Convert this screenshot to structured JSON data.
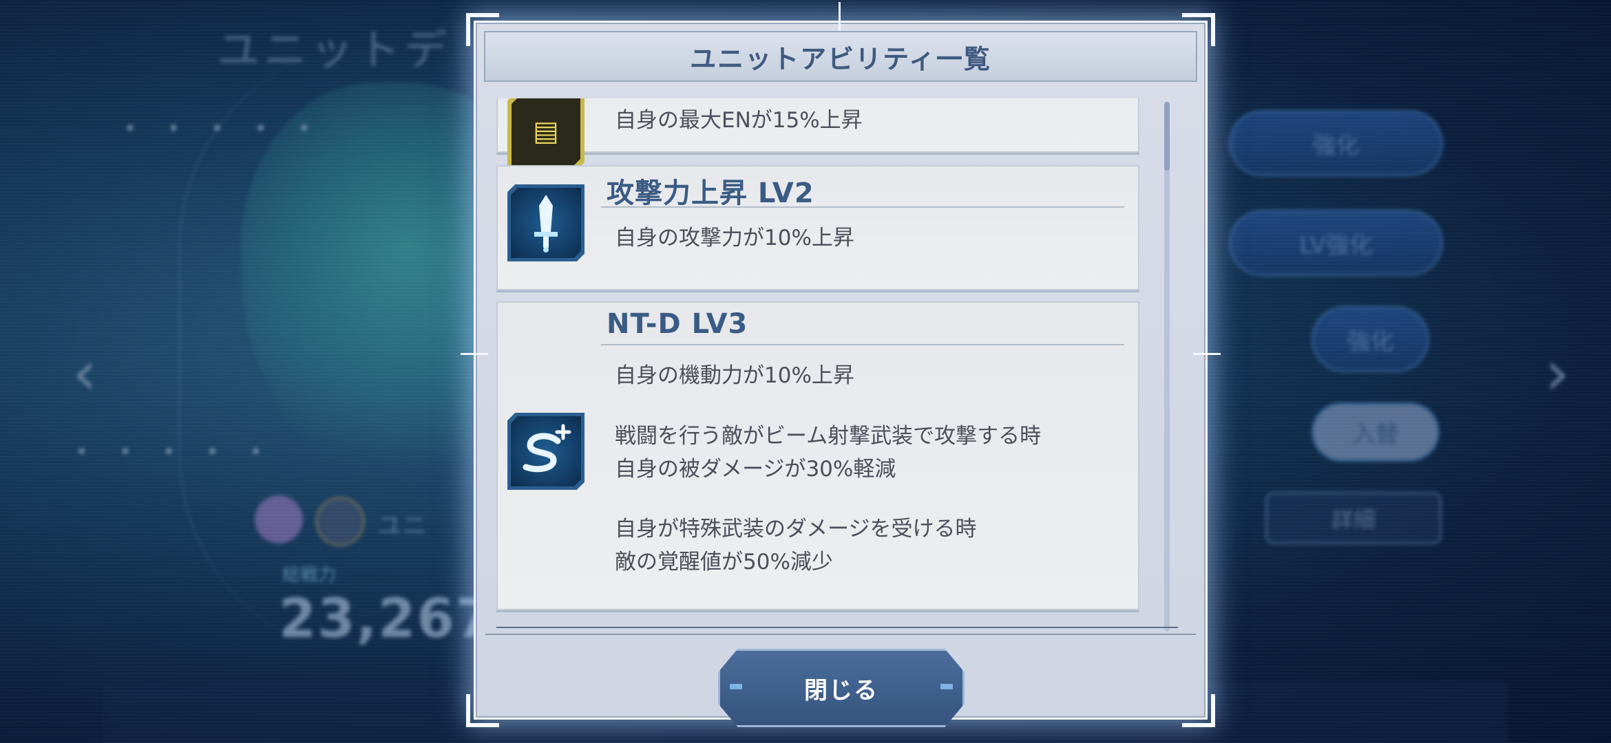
{
  "background": {
    "screen_title": "ユニットデ",
    "power_label": "総戦力",
    "power_value": "23,267",
    "unit_label": "ユニ",
    "buttons": [
      "強化",
      "LV強化",
      "強化",
      "入替"
    ],
    "detail_label": "詳細"
  },
  "dialog": {
    "title": "ユニットアビリティ一覧",
    "abilities": [
      {
        "name": "",
        "icon": "en-battery-icon",
        "descriptions": [
          "自身の最大ENが15%上昇"
        ]
      },
      {
        "name": "攻撃力上昇 LV2",
        "icon": "sword-icon",
        "descriptions": [
          "自身の攻撃力が10%上昇"
        ]
      },
      {
        "name": "NT-D LV3",
        "icon": "s-plus-icon",
        "descriptions": [
          "自身の機動力が10%上昇",
          "戦闘を行う敵がビーム射撃武装で攻撃する時\n自身の被ダメージが30%軽減",
          "自身が特殊武装のダメージを受ける時\n敵の覚醒値が50%減少"
        ]
      }
    ],
    "close_label": "閉じる"
  },
  "colors": {
    "title_text": "#3f5a80",
    "ability_name": "#3a5b84",
    "close_button": "#3b5a86"
  }
}
